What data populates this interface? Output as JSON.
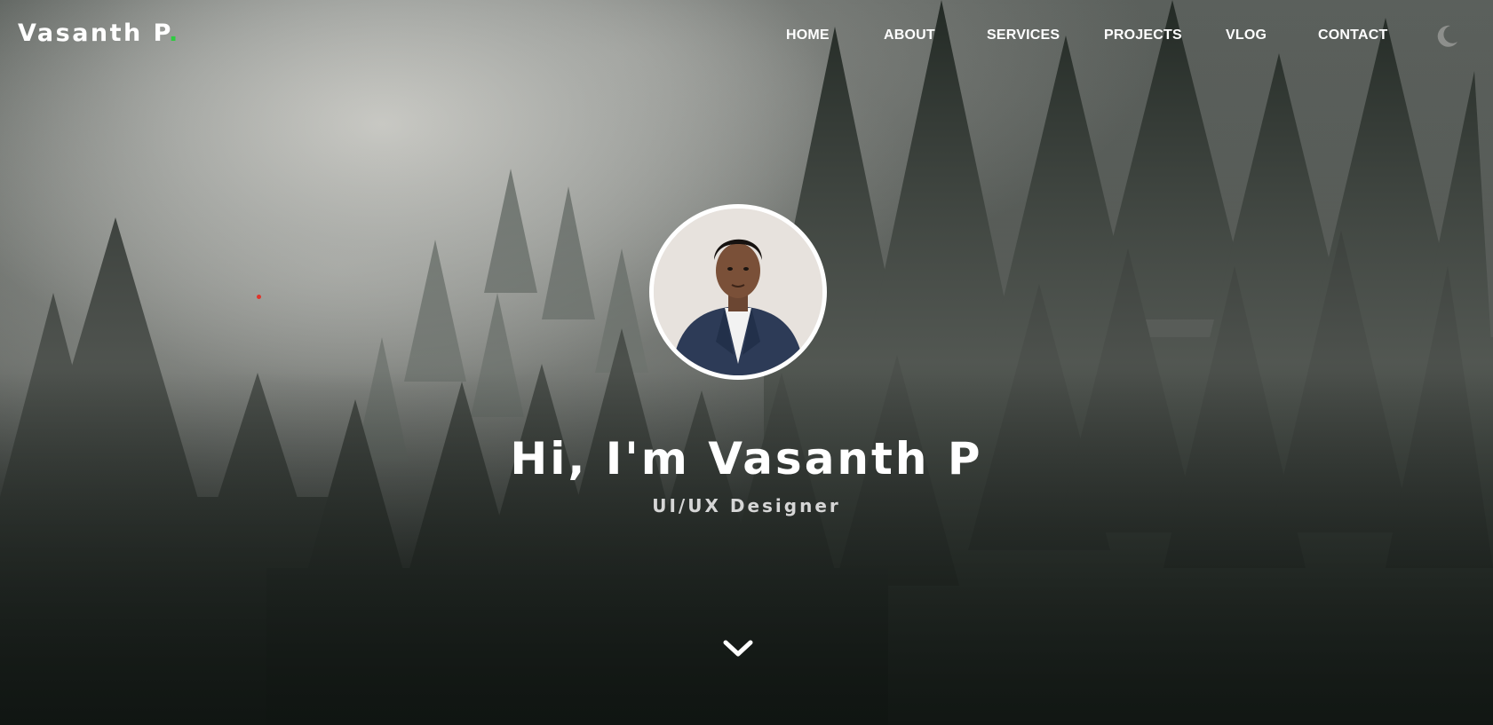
{
  "brand": {
    "name": "Vasanth P",
    "dot": ".",
    "dot_color": "#2ecc40"
  },
  "nav": {
    "items": [
      {
        "label": "HOME"
      },
      {
        "label": "ABOUT"
      },
      {
        "label": "SERVICES"
      },
      {
        "label": "PROJECTS"
      },
      {
        "label": "VLOG"
      },
      {
        "label": "CONTACT"
      }
    ],
    "theme_toggle_icon": "moon-icon"
  },
  "hero": {
    "headline": "Hi, I'm Vasanth P",
    "subtitle": "UI/UX Designer",
    "avatar_icon": "profile-photo",
    "scroll_icon": "chevron-down-icon",
    "background": "misty-forest-photo"
  },
  "colors": {
    "text": "#ffffff",
    "subtitle": "#d6d6d6",
    "accent_green": "#2ecc40",
    "cursor_red": "#e0342b"
  }
}
